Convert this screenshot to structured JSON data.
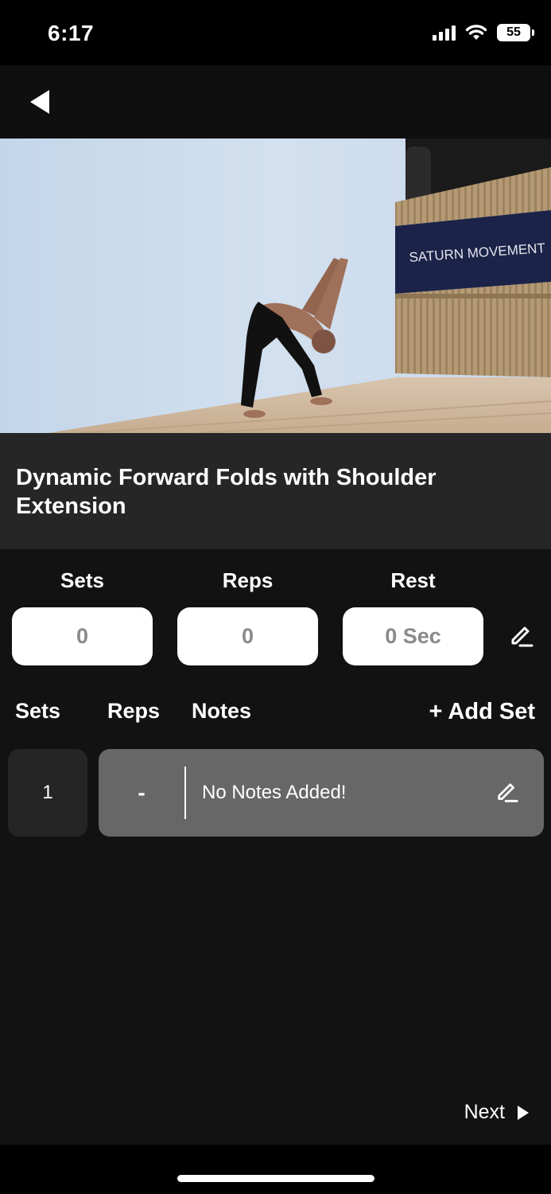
{
  "status": {
    "time": "6:17",
    "battery": "55"
  },
  "icons": {
    "back": "back-triangle-icon",
    "edit": "pencil-edit-icon",
    "next": "play-triangle-icon",
    "signal": "cellular-signal-icon",
    "wifi": "wifi-icon",
    "battery": "battery-icon"
  },
  "video": {
    "banner_text": "SATURN MOVEMENT"
  },
  "exercise": {
    "title": "Dynamic Forward Folds with Shoulder Extension"
  },
  "summary": {
    "sets_label": "Sets",
    "reps_label": "Reps",
    "rest_label": "Rest",
    "sets_value": "0",
    "reps_value": "0",
    "rest_value": "0 Sec"
  },
  "table": {
    "headers": {
      "sets": "Sets",
      "reps": "Reps",
      "notes": "Notes"
    },
    "add_set_label": "+ Add Set",
    "rows": [
      {
        "set": "1",
        "reps": "-",
        "notes": "No Notes Added!"
      }
    ]
  },
  "footer": {
    "next_label": "Next"
  },
  "colors": {
    "background": "#121212",
    "title_panel": "#262626",
    "row_bg": "#676767",
    "set_cell_bg": "#252525",
    "input_text": "#8a8a8a"
  }
}
